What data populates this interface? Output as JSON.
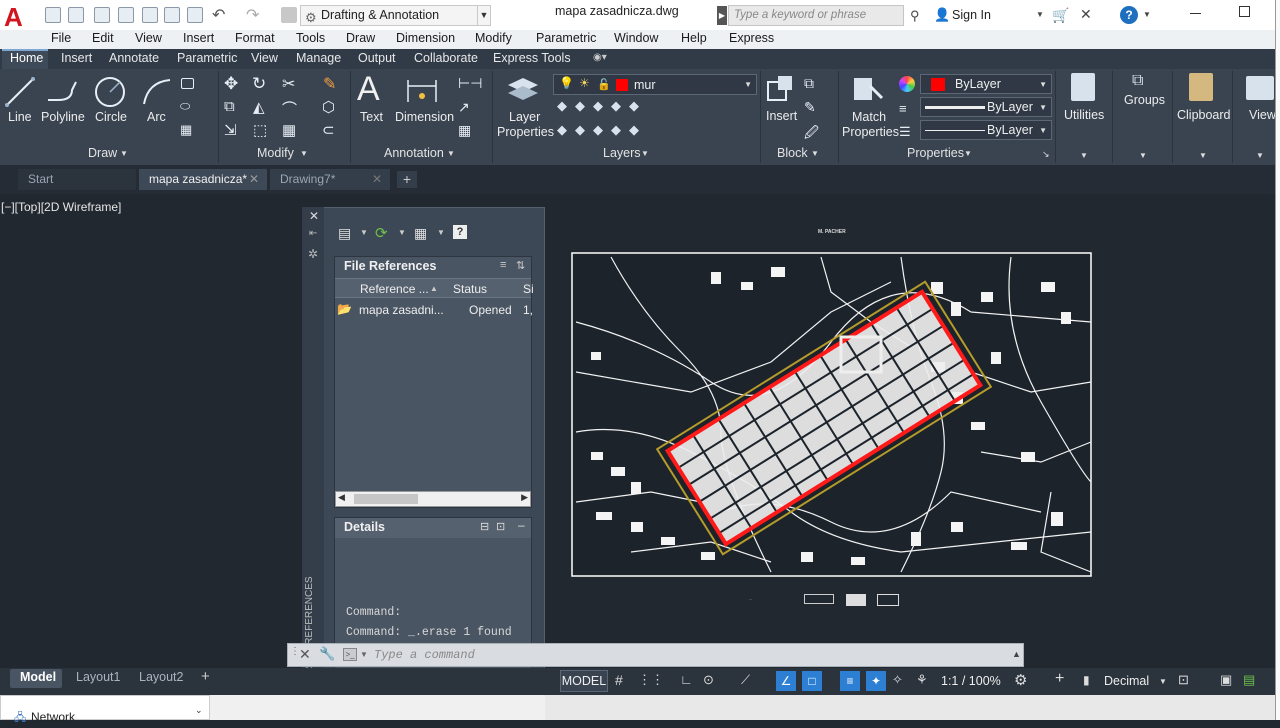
{
  "app": {
    "logo_letter": "A",
    "workspace": "Drafting & Annotation",
    "document_title": "mapa zasadnicza.dwg",
    "search_placeholder": "Type a keyword or phrase",
    "signin": "Sign In",
    "help": "?"
  },
  "menu": [
    "File",
    "Edit",
    "View",
    "Insert",
    "Format",
    "Tools",
    "Draw",
    "Dimension",
    "Modify",
    "Parametric",
    "Window",
    "Help",
    "Express"
  ],
  "ribbon_tabs": [
    "Home",
    "Insert",
    "Annotate",
    "Parametric",
    "View",
    "Manage",
    "Output",
    "Collaborate",
    "Express Tools"
  ],
  "ribbon": {
    "draw": {
      "title": "Draw",
      "tools": [
        "Line",
        "Polyline",
        "Circle",
        "Arc"
      ]
    },
    "modify": {
      "title": "Modify"
    },
    "annotation": {
      "title": "Annotation",
      "tools": [
        "Text",
        "Dimension"
      ]
    },
    "layers": {
      "title": "Layers",
      "layer_properties_1": "Layer",
      "layer_properties_2": "Properties",
      "current_layer": "mur"
    },
    "block": {
      "title": "Block",
      "insert": "Insert"
    },
    "properties": {
      "title": "Properties",
      "match_1": "Match",
      "match_2": "Properties",
      "color": "ByLayer",
      "linetype": "ByLayer",
      "lineweight": "ByLayer"
    },
    "utilities": "Utilities",
    "groups": "Groups",
    "clipboard": "Clipboard",
    "view": "View"
  },
  "file_tabs": [
    "Start",
    "mapa zasadnicza*",
    "Drawing7*"
  ],
  "viewport_label": "[−][Top][2D Wireframe]",
  "xref_palette": {
    "file_references_title": "File References",
    "columns": [
      "Reference ...",
      "Status",
      "Si"
    ],
    "rows": [
      {
        "name": "mapa zasadni...",
        "status": "Opened",
        "size": "1,"
      }
    ],
    "details_title": "Details",
    "side_label": "EXTERNAL REFERENCES"
  },
  "command_history": [
    "Command:",
    "Command: _.erase 1 found"
  ],
  "command_placeholder": "Type a command",
  "layout_tabs": [
    "Model",
    "Layout1",
    "Layout2"
  ],
  "status": {
    "model": "MODEL",
    "scale": "1:1 / 100%",
    "units": "Decimal"
  },
  "bottom": {
    "network": "Network"
  },
  "drawing": {
    "header_text": "M. PACHER",
    "footer_labels": [
      "...",
      "..."
    ]
  },
  "colors": {
    "accent": "#d1161e",
    "ribbon": "#3a4451",
    "canvas": "#212830",
    "boundary_red": "#ff1a1a",
    "boundary_yellow": "#b59b2a"
  }
}
